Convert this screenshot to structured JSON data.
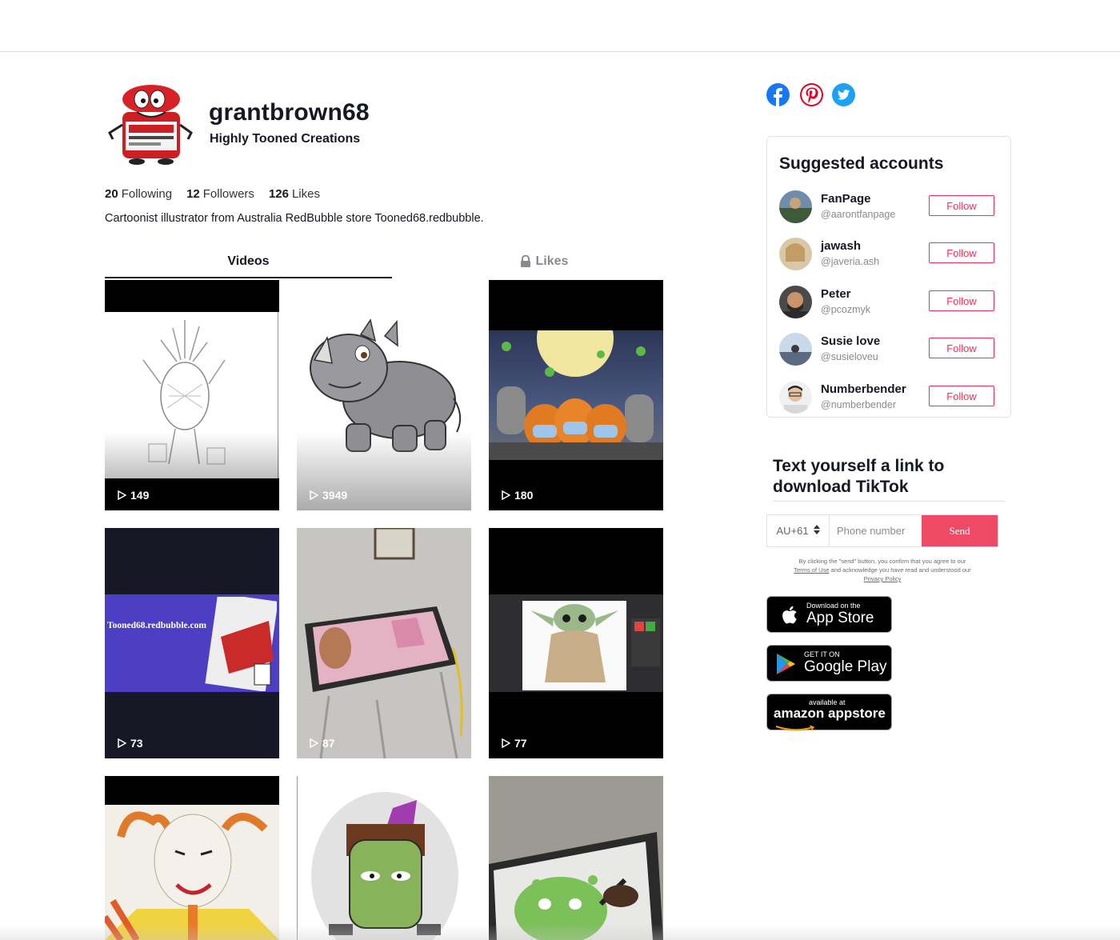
{
  "profile": {
    "username": "grantbrown68",
    "display_name": "Highly Tooned Creations",
    "stats": [
      {
        "value": "20",
        "label": "Following"
      },
      {
        "value": "12",
        "label": "Followers"
      },
      {
        "value": "126",
        "label": "Likes"
      }
    ],
    "bio": "Cartoonist illustrator from Australia RedBubble store Tooned68.redbubble."
  },
  "tabs": {
    "videos": "Videos",
    "likes": "Likes"
  },
  "videos": [
    {
      "views": "149"
    },
    {
      "views": "3949"
    },
    {
      "views": "180"
    },
    {
      "views": "73"
    },
    {
      "views": "87"
    },
    {
      "views": "77"
    },
    {
      "views": ""
    },
    {
      "views": ""
    },
    {
      "views": ""
    }
  ],
  "video_text": {
    "redbubble_banner": "Tooned68.redbubble.com"
  },
  "share": [
    "facebook-icon",
    "pinterest-icon",
    "twitter-icon"
  ],
  "suggested": {
    "title": "Suggested accounts",
    "follow_label": "Follow",
    "accounts": [
      {
        "name": "FanPage",
        "handle": "@aarontfanpage"
      },
      {
        "name": "jawash",
        "handle": "@javeria.ash"
      },
      {
        "name": "Peter",
        "handle": "@pcozmyk"
      },
      {
        "name": "Susie love",
        "handle": "@susieloveu"
      },
      {
        "name": "Numberbender",
        "handle": "@numberbender"
      }
    ]
  },
  "download": {
    "title": "Text yourself a link to download TikTok",
    "country_code": "AU+61",
    "phone_placeholder": "Phone number",
    "send_label": "Send",
    "legal_1": "By clicking the \"send\" button, you confirm that you agree to our",
    "terms_link": "Terms of Use",
    "legal_2": "and acknowledge you have read and understood our",
    "privacy_link": "Privacy Policy"
  },
  "stores": {
    "apple_small": "Download on the",
    "apple_big": "App Store",
    "google_small": "GET IT ON",
    "google_big": "Google Play",
    "amazon_small": "available at",
    "amazon_big": "amazon appstore"
  },
  "colors": {
    "accent": "#fe2c55",
    "send": "#ee4a66"
  }
}
